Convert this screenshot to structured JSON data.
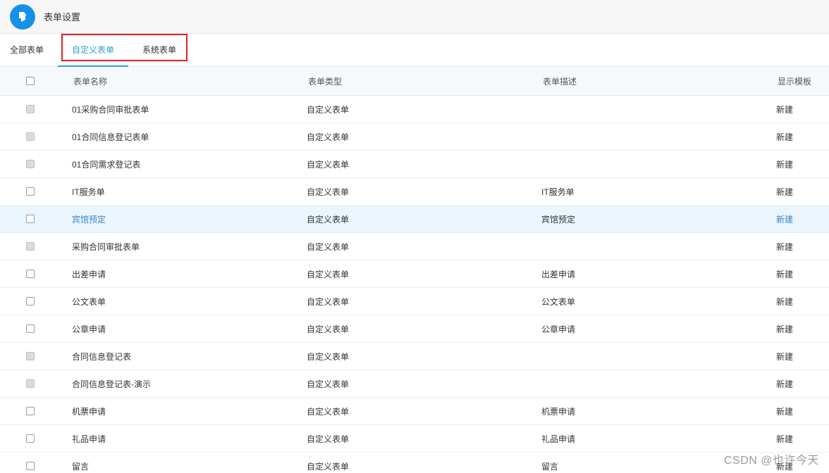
{
  "header": {
    "title": "表单设置",
    "logo_icon": "logo-icon",
    "accent_color": "#1890e8"
  },
  "tabs": [
    {
      "label": "全部表单",
      "active": false
    },
    {
      "label": "自定义表单",
      "active": true
    },
    {
      "label": "系统表单",
      "active": false
    }
  ],
  "table": {
    "columns": [
      "表单名称",
      "表单类型",
      "表单描述",
      "显示模板"
    ],
    "rows": [
      {
        "name": "01采购合同审批表单",
        "type": "自定义表单",
        "desc": "",
        "template": "新建",
        "disabled": true
      },
      {
        "name": "01合同信息登记表单",
        "type": "自定义表单",
        "desc": "",
        "template": "新建",
        "disabled": true
      },
      {
        "name": "01合同需求登记表",
        "type": "自定义表单",
        "desc": "",
        "template": "新建",
        "disabled": true
      },
      {
        "name": "IT服务单",
        "type": "自定义表单",
        "desc": "IT服务单",
        "template": "新建",
        "disabled": false
      },
      {
        "name": "宾馆预定",
        "type": "自定义表单",
        "desc": "宾馆预定",
        "template": "新建",
        "disabled": false,
        "hover": true
      },
      {
        "name": "采购合同审批表单",
        "type": "自定义表单",
        "desc": "",
        "template": "新建",
        "disabled": true
      },
      {
        "name": "出差申请",
        "type": "自定义表单",
        "desc": "出差申请",
        "template": "新建",
        "disabled": false
      },
      {
        "name": "公文表单",
        "type": "自定义表单",
        "desc": "公文表单",
        "template": "新建",
        "disabled": false
      },
      {
        "name": "公章申请",
        "type": "自定义表单",
        "desc": "公章申请",
        "template": "新建",
        "disabled": false
      },
      {
        "name": "合同信息登记表",
        "type": "自定义表单",
        "desc": "",
        "template": "新建",
        "disabled": true
      },
      {
        "name": "合同信息登记表-演示",
        "type": "自定义表单",
        "desc": "",
        "template": "新建",
        "disabled": true
      },
      {
        "name": "机票申请",
        "type": "自定义表单",
        "desc": "机票申请",
        "template": "新建",
        "disabled": false
      },
      {
        "name": "礼品申请",
        "type": "自定义表单",
        "desc": "礼品申请",
        "template": "新建",
        "disabled": false
      },
      {
        "name": "留言",
        "type": "自定义表单",
        "desc": "留言",
        "template": "新建",
        "disabled": false
      }
    ]
  },
  "watermark": "CSDN @也许今天"
}
